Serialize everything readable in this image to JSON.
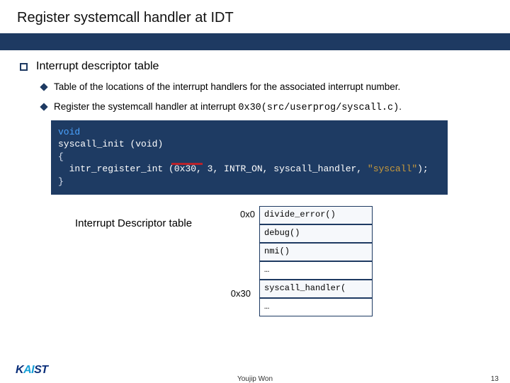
{
  "title": "Register systemcall handler at IDT",
  "section": "Interrupt descriptor table",
  "bullets": {
    "b1": "Table of the locations of the interrupt handlers for the associated interrupt number.",
    "b2_prefix": "Register the systemcall handler at interrupt ",
    "b2_code": "0x30(src/userprog/syscall.c)",
    "b2_suffix": "."
  },
  "code": {
    "kw1": "void",
    "fn": "syscall_init",
    "params1": "(void)",
    "brace_open": "{",
    "call_fn": "intr_register_int",
    "args_left": "(0x30, 3, INTR_ON, syscall_handler, ",
    "str": "\"syscall\"",
    "args_right": ");",
    "brace_close": "}"
  },
  "idt": {
    "caption": "Interrupt Descriptor  table",
    "labels": {
      "l0": "0x0",
      "l30": "0x30"
    },
    "rows": {
      "r0": "divide_error()",
      "r1": "debug()",
      "r2": "nmi()",
      "r3": "…",
      "r4": "syscall_handler(",
      "r5": "…"
    }
  },
  "footer": {
    "author": "Youjip Won",
    "page": "13"
  },
  "logo": {
    "k": "K",
    "ai": "AI",
    "st": "ST"
  }
}
